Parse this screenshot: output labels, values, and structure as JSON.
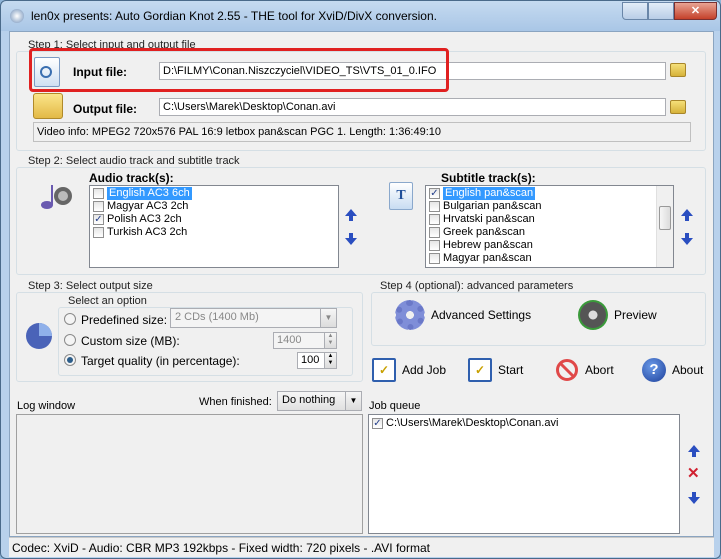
{
  "window": {
    "title": "len0x presents: Auto Gordian Knot 2.55 - THE tool for XviD/DivX conversion."
  },
  "step1": {
    "label": "Step 1: Select input and output file",
    "input_label": "Input file:",
    "input_value": "D:\\FILMY\\Conan.Niszczyciel\\VIDEO_TS\\VTS_01_0.IFO",
    "output_label": "Output file:",
    "output_value": "C:\\Users\\Marek\\Desktop\\Conan.avi",
    "video_info": "Video info: MPEG2 720x576 PAL 16:9 letbox pan&scan PGC 1. Length: 1:36:49:10",
    "highlight_color": "#e02020"
  },
  "step2": {
    "label": "Step 2: Select audio track and subtitle track",
    "audio_label": "Audio track(s):",
    "audio_tracks": [
      {
        "label": "English AC3 6ch",
        "checked": false,
        "selected": true
      },
      {
        "label": "Magyar AC3 2ch",
        "checked": false
      },
      {
        "label": "Polish AC3 2ch",
        "checked": true
      },
      {
        "label": "Turkish AC3 2ch",
        "checked": false
      }
    ],
    "subtitle_label": "Subtitle track(s):",
    "subtitle_tracks": [
      {
        "label": "English pan&scan",
        "checked": true,
        "selected": true
      },
      {
        "label": "Bulgarian pan&scan",
        "checked": false
      },
      {
        "label": "Hrvatski pan&scan",
        "checked": false
      },
      {
        "label": "Greek pan&scan",
        "checked": false
      },
      {
        "label": "Hebrew pan&scan",
        "checked": false
      },
      {
        "label": "Magyar pan&scan",
        "checked": false
      }
    ]
  },
  "step3": {
    "label": "Step 3: Select output size",
    "option_label": "Select an option",
    "predefined_label": "Predefined size:",
    "predefined_value": "2 CDs (1400 Mb)",
    "custom_label": "Custom size (MB):",
    "custom_value": "1400",
    "quality_label": "Target quality (in percentage):",
    "quality_value": "100",
    "selected": "quality"
  },
  "step4": {
    "label": "Step 4 (optional): advanced parameters",
    "advanced": "Advanced Settings",
    "preview": "Preview"
  },
  "actions": {
    "add_job": "Add Job",
    "start": "Start",
    "abort": "Abort",
    "about": "About"
  },
  "log": {
    "label": "Log window",
    "when_finished_label": "When finished:",
    "when_finished_value": "Do nothing"
  },
  "queue": {
    "label": "Job queue",
    "items": [
      {
        "label": "C:\\Users\\Marek\\Desktop\\Conan.avi",
        "checked": true
      }
    ]
  },
  "status": "Codec: XviD -  Audio: CBR MP3 192kbps -  Fixed width: 720 pixels - .AVI format"
}
